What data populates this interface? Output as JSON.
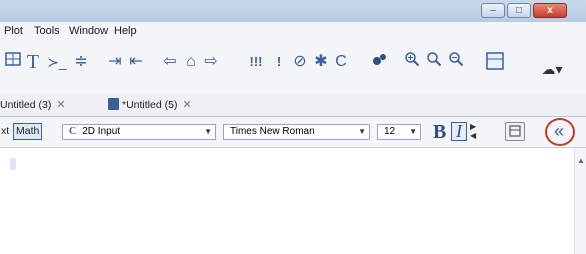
{
  "menu": [
    "Plot",
    "Tools",
    "Window",
    "Help"
  ],
  "window_controls": {
    "minimize": "–",
    "maximize": "□",
    "close": "x"
  },
  "toolbar": {
    "text_icon": "T",
    "prompt_icon": "≻_",
    "format_icon": "≑",
    "indent_icon": "⇥",
    "outdent_icon": "⇤",
    "back_icon": "⇦",
    "home_icon": "⌂",
    "forward_icon": "⇨",
    "execute_all": "!!!",
    "execute": "!",
    "stop_icon": "⊘",
    "debug_icon": "✱",
    "restart_icon": "C",
    "zoom_icons": [
      "zoom-in-icon",
      "zoom-icon",
      "zoom-out-icon"
    ],
    "cloud_icon": "☁▾"
  },
  "tabs": [
    {
      "label": "Untitled (3)",
      "close": "✕"
    },
    {
      "label": "*Untitled (5)",
      "close": "✕"
    }
  ],
  "format": {
    "text_label": "xt",
    "math_label": "Math",
    "input_mode_icon": "C",
    "input_mode": "2D Input",
    "font": "Times New Roman",
    "size": "12",
    "bold": "B",
    "italic": "I",
    "collapse": "«"
  },
  "colors": {
    "accent": "#3a5f9e",
    "highlight_ring": "#c0392b"
  }
}
